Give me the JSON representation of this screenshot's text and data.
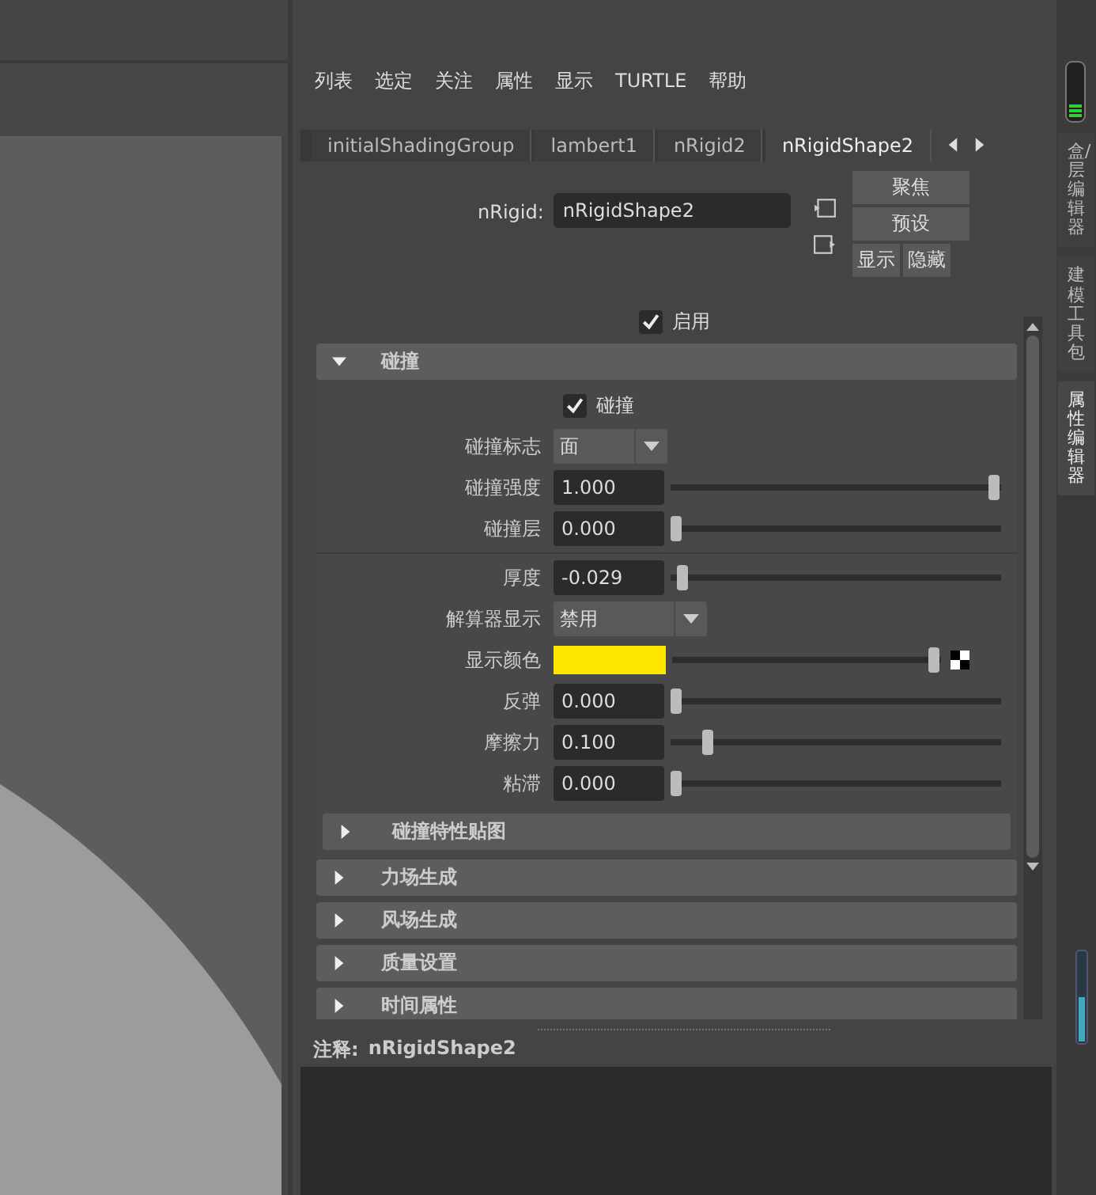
{
  "menu": [
    "列表",
    "选定",
    "关注",
    "属性",
    "显示",
    "TURTLE",
    "帮助"
  ],
  "tabs": [
    {
      "label": "initialShadingGroup",
      "selected": false
    },
    {
      "label": "lambert1",
      "selected": false
    },
    {
      "label": "nRigid2",
      "selected": false
    },
    {
      "label": "nRigidShape2",
      "selected": true
    }
  ],
  "node": {
    "label": "nRigid:",
    "value": "nRigidShape2"
  },
  "node_buttons": [
    "聚焦",
    "预设",
    "显示",
    "隐藏"
  ],
  "enable": {
    "label": "启用",
    "checked": true
  },
  "sections": [
    {
      "title": "碰撞",
      "expanded": true,
      "rows": [
        {
          "kind": "checkbox",
          "label": "碰撞",
          "checked": true
        },
        {
          "kind": "dropdown",
          "label": "碰撞标志",
          "value": "面"
        },
        {
          "kind": "slider",
          "label": "碰撞强度",
          "value": "1.000",
          "level": 1
        },
        {
          "kind": "slider",
          "label": "碰撞层",
          "value": "0.000",
          "level": 0
        },
        {
          "kind": "divider"
        },
        {
          "kind": "slider",
          "label": "厚度",
          "value": "-0.029",
          "level": 0.02
        },
        {
          "kind": "dropdown",
          "label": "解算器显示",
          "value": "禁用"
        },
        {
          "kind": "color",
          "label": "显示颜色",
          "color": "#ffe600",
          "level": 1
        },
        {
          "kind": "slider",
          "label": "反弹",
          "value": "0.000",
          "level": 0
        },
        {
          "kind": "slider",
          "label": "摩擦力",
          "value": "0.100",
          "level": 0.1
        },
        {
          "kind": "slider",
          "label": "粘滞",
          "value": "0.000",
          "level": 0
        },
        {
          "kind": "subsection",
          "label": "碰撞特性贴图",
          "expanded": false
        }
      ]
    },
    {
      "title": "力场生成",
      "expanded": false
    },
    {
      "title": "风场生成",
      "expanded": false
    },
    {
      "title": "质量设置",
      "expanded": false
    },
    {
      "title": "时间属性",
      "expanded": false
    }
  ],
  "notes": {
    "label": "注释:",
    "value": "nRigidShape2"
  },
  "side_tabs": [
    {
      "label": "盒/层编辑器",
      "selected": false
    },
    {
      "label": "建模工具包",
      "selected": false
    },
    {
      "label": "属性编辑器",
      "selected": true
    }
  ]
}
